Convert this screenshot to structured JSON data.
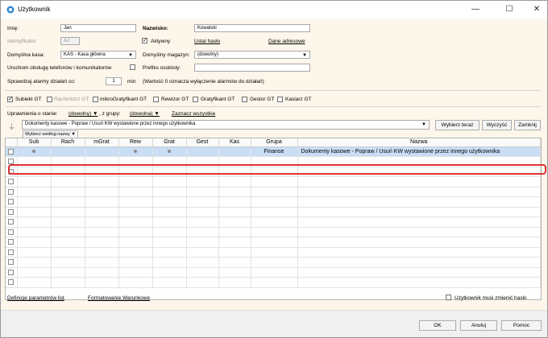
{
  "window": {
    "title": "Użytkownik"
  },
  "form": {
    "imie_label": "Imię:",
    "imie_value": "Jan",
    "nazwisko_label": "Nazwisko:",
    "nazwisko_value": "Kowalski",
    "identyfikator_label": "Identyfikator:",
    "identyfikator_value": "AJ",
    "aktywny_label": "Aktywny",
    "ustal_haslo": "Ustal hasło",
    "dane_adresowe": "Dane adresowe",
    "kasa_label": "Domyślna kasa:",
    "kasa_value": "KAS - Kasa główna",
    "magazyn_label": "Domyślny magazyn:",
    "magazyn_value": "(dowolny)",
    "telefony_label": "Uruchom obsługę telefonów i komunikatorów",
    "prefiks_label": "Prefiks osobisty:",
    "prefiks_value": "",
    "alarmy_label": "Sprawdzaj alarmy działań co:",
    "alarmy_value": "1",
    "alarmy_unit": "min",
    "alarmy_note": "(Wartość 0 oznacza wyłączenie alarmów do działań)"
  },
  "modules": [
    {
      "label": "Subiekt GT",
      "checked": true,
      "enabled": true
    },
    {
      "label": "Rachmistrz GT",
      "checked": false,
      "enabled": false
    },
    {
      "label": "mikroGratyfikant GT",
      "checked": false,
      "enabled": true
    },
    {
      "label": "Rewizor GT",
      "checked": false,
      "enabled": true
    },
    {
      "label": "Gratyfikant GT",
      "checked": false,
      "enabled": true
    },
    {
      "label": "Gestor GT",
      "checked": false,
      "enabled": true
    },
    {
      "label": "Kasiarz GT",
      "checked": false,
      "enabled": true
    }
  ],
  "filters": {
    "stan_label": "Uprawnienia o stanie:",
    "stan_value": "(dowolny)",
    "grupy_label": ", z grupy:",
    "grupy_value": "(dowolna)",
    "zaznacz": "Zaznacz wszystkie",
    "search_value": "Dokumenty kasowe - Popraw / Usuń KW wystawione przez innego użytkownika",
    "wybierz_teraz": "Wybierz teraz",
    "wyczysc": "Wyczyść",
    "zamknij": "Zamknij",
    "wybierz_wedlug": "Wybierz według nazwy"
  },
  "grid": {
    "columns": [
      "Sub",
      "Rach",
      "mGrat",
      "Rew",
      "Grat",
      "Gest",
      "Kas",
      "Grupa",
      "Nazwa"
    ],
    "row": {
      "group": "Finanse",
      "name": "Dokumenty kasowe - Popraw / Usuń KW wystawione przez innego użytkownika",
      "dots": [
        "Sub",
        "Rew",
        "Grat"
      ]
    }
  },
  "bottom": {
    "definicje": "Definicje parametrów list",
    "formatowanie": "Formatowanie Warunkowe",
    "zmienic_haslo": "Użytkownik musi zmienić hasło"
  },
  "buttons": {
    "ok": "OK",
    "anuluj": "Anuluj",
    "pomoc": "Pomoc"
  }
}
